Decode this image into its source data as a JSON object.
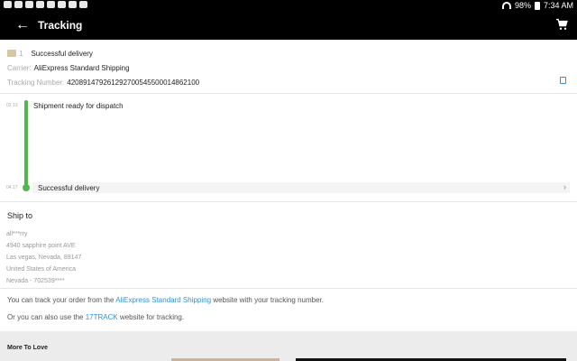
{
  "status_bar": {
    "battery": "98%",
    "time": "7:34 AM"
  },
  "app_bar": {
    "title": "Tracking"
  },
  "package": {
    "number": "1",
    "status": "Successful delivery",
    "carrier_label": "Carrier:",
    "carrier": "AliExpress Standard Shipping",
    "tracking_label": "Tracking Number:",
    "tracking_number": "420891479261292700545500014862100"
  },
  "timeline": [
    {
      "time": "02:13",
      "event": "Shipment ready for dispatch"
    },
    {
      "time": "04:17",
      "event": "Successful delivery"
    }
  ],
  "ship_to": {
    "title": "Ship to",
    "lines": [
      "all***rry",
      "4940 sapphire point AVE",
      "Las vegas, Nevada, 89147",
      "United States of America",
      "Nevada - 702539****"
    ]
  },
  "tracking_info": {
    "line1_pre": "You can track your order from the ",
    "line1_link": "AliExpress Standard Shipping",
    "line1_post": " website with your tracking number.",
    "line2_pre": "Or you can also use the ",
    "line2_link": "17TRACK",
    "line2_post": " website for tracking."
  },
  "more_to_love": {
    "title": "More To Love"
  },
  "colors": {
    "accent_green": "#4fb84a",
    "link_blue": "#2f8fe0",
    "app_bar": "#000000"
  }
}
